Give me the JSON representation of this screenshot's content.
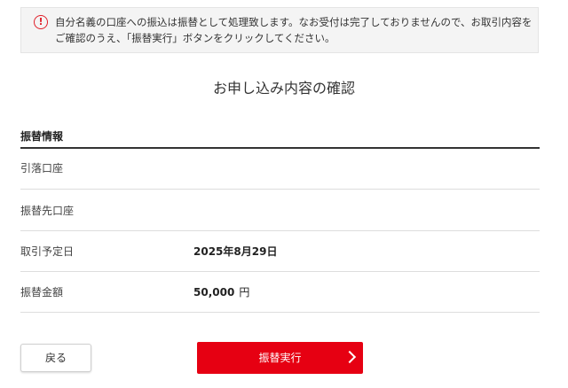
{
  "notice": {
    "icon": "exclamation-circle-icon",
    "line1": "自分名義の口座への振込は振替として処理致します。なお受付は完了しておりませんので、お取引内容を",
    "line2": "ご確認のうえ、「振替実行」ボタンをクリックしてください。",
    "icon_color": "#e0202a"
  },
  "page_title": "お申し込み内容の確認",
  "section": {
    "title": "振替情報",
    "rows": [
      {
        "label": "引落口座",
        "value": "",
        "unit": ""
      },
      {
        "label": "振替先口座",
        "value": "",
        "unit": ""
      },
      {
        "label": "取引予定日",
        "value": "2025年8月29日",
        "unit": ""
      },
      {
        "label": "振替金額",
        "value": "50,000",
        "unit": "円"
      }
    ]
  },
  "buttons": {
    "back_label": "戻る",
    "execute_label": "振替実行",
    "execute_color": "#e60012",
    "execute_icon": "chevron-right-icon"
  }
}
